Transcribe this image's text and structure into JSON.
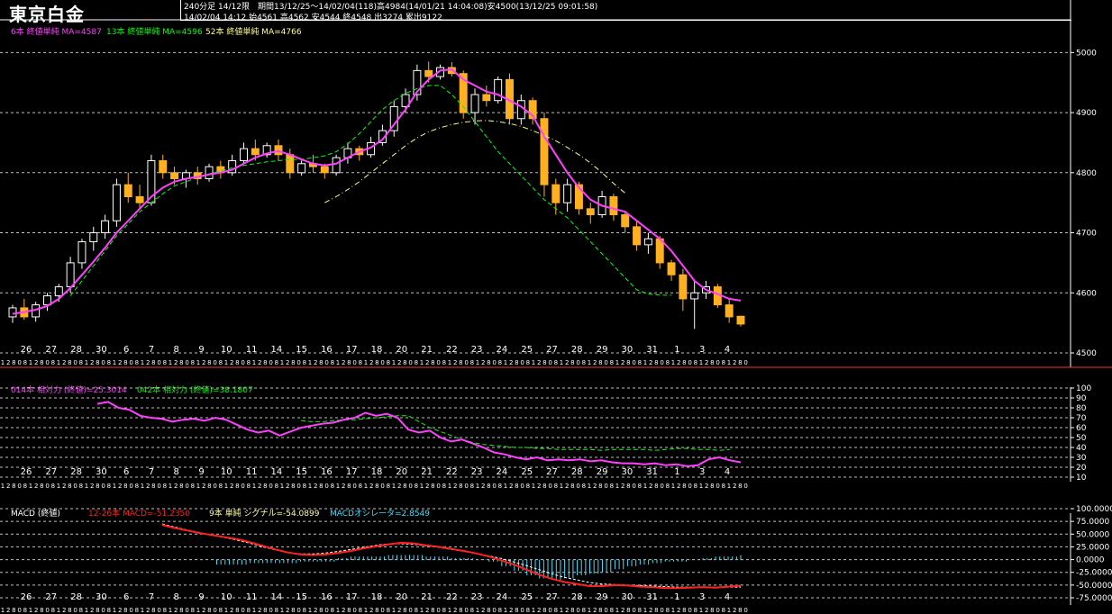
{
  "header": {
    "title": "東京白金",
    "line1": "240分足 14/12限　期間13/12/25〜14/02/04(118)高4984(14/01/21 14:04:08)安4500(13/12/25 09:01:58)",
    "line2": "14/02/04 14:12 始4561 高4562 安4544 終4548 出3274 累出9122"
  },
  "colors": {
    "up": "#ffffff",
    "down": "#ffb020",
    "ma6": "#ff40ff",
    "ma13": "#00ff00",
    "ma52": "#ffff80",
    "rsi14": "#ff40ff",
    "rsi42": "#00ff00",
    "macd": "#ff2020",
    "signal": "#ffffff",
    "osc": "#40e0ff",
    "grid": "#ffffff",
    "separator": "#ff3030"
  },
  "legends": {
    "price": [
      "6本 終値単純 MA=4587",
      "13本 終値単純 MA=4596",
      "52本 終値単純 MA=4766"
    ],
    "rsi": [
      "014本 相対力 (終値)=25.3014",
      "042本 相対力 (終値)=38.1807"
    ],
    "macd": [
      "MACD (終値)",
      "12-26本 MACD=-51.2350",
      "9本 単純 シグナル=-54.0899",
      "MACDオシレータ=2.8549"
    ]
  },
  "chart_data": [
    {
      "type": "candlestick",
      "ylim": [
        4500,
        5020
      ],
      "yticks": [
        "5000",
        "4900",
        "4800",
        "4700",
        "4600",
        "4500"
      ],
      "date_labels": [
        "26",
        "27",
        "28",
        "30",
        "6",
        "7",
        "8",
        "9",
        "10",
        "11",
        "14",
        "15",
        "16",
        "17",
        "18",
        "20",
        "21",
        "22",
        "23",
        "24",
        "25",
        "27",
        "28",
        "29",
        "30",
        "31",
        "1",
        "3",
        "4"
      ],
      "session_labels": [
        "1",
        "2",
        "8",
        "0",
        "8",
        "1",
        "2",
        "8",
        "0",
        "8"
      ],
      "candles": [
        [
          4560,
          4580,
          4550,
          4575
        ],
        [
          4575,
          4590,
          4555,
          4560
        ],
        [
          4560,
          4585,
          4552,
          4580
        ],
        [
          4580,
          4600,
          4570,
          4595
        ],
        [
          4595,
          4615,
          4585,
          4610
        ],
        [
          4610,
          4660,
          4600,
          4650
        ],
        [
          4650,
          4690,
          4640,
          4685
        ],
        [
          4685,
          4710,
          4670,
          4700
        ],
        [
          4700,
          4730,
          4690,
          4720
        ],
        [
          4720,
          4790,
          4710,
          4780
        ],
        [
          4780,
          4800,
          4750,
          4760
        ],
        [
          4760,
          4780,
          4740,
          4750
        ],
        [
          4750,
          4830,
          4745,
          4820
        ],
        [
          4820,
          4830,
          4790,
          4800
        ],
        [
          4800,
          4810,
          4780,
          4790
        ],
        [
          4790,
          4805,
          4775,
          4800
        ],
        [
          4800,
          4810,
          4780,
          4790
        ],
        [
          4790,
          4815,
          4785,
          4810
        ],
        [
          4810,
          4820,
          4790,
          4800
        ],
        [
          4800,
          4830,
          4795,
          4820
        ],
        [
          4820,
          4850,
          4815,
          4840
        ],
        [
          4840,
          4855,
          4820,
          4830
        ],
        [
          4830,
          4850,
          4825,
          4845
        ],
        [
          4845,
          4855,
          4820,
          4830
        ],
        [
          4830,
          4840,
          4790,
          4800
        ],
        [
          4800,
          4820,
          4795,
          4815
        ],
        [
          4815,
          4830,
          4800,
          4810
        ],
        [
          4810,
          4815,
          4790,
          4800
        ],
        [
          4800,
          4830,
          4795,
          4825
        ],
        [
          4825,
          4850,
          4815,
          4840
        ],
        [
          4840,
          4845,
          4820,
          4830
        ],
        [
          4830,
          4860,
          4825,
          4850
        ],
        [
          4850,
          4880,
          4845,
          4870
        ],
        [
          4870,
          4920,
          4860,
          4910
        ],
        [
          4910,
          4940,
          4900,
          4930
        ],
        [
          4930,
          4980,
          4920,
          4970
        ],
        [
          4970,
          4985,
          4950,
          4960
        ],
        [
          4960,
          4980,
          4955,
          4975
        ],
        [
          4975,
          4984,
          4960,
          4965
        ],
        [
          4965,
          4970,
          4890,
          4900
        ],
        [
          4900,
          4940,
          4880,
          4930
        ],
        [
          4930,
          4945,
          4910,
          4920
        ],
        [
          4920,
          4960,
          4915,
          4955
        ],
        [
          4955,
          4965,
          4880,
          4890
        ],
        [
          4890,
          4930,
          4880,
          4920
        ],
        [
          4920,
          4925,
          4880,
          4890
        ],
        [
          4890,
          4900,
          4760,
          4780
        ],
        [
          4780,
          4790,
          4730,
          4750
        ],
        [
          4750,
          4790,
          4735,
          4780
        ],
        [
          4780,
          4785,
          4730,
          4740
        ],
        [
          4740,
          4750,
          4715,
          4730
        ],
        [
          4730,
          4770,
          4725,
          4760
        ],
        [
          4760,
          4765,
          4720,
          4730
        ],
        [
          4730,
          4735,
          4700,
          4710
        ],
        [
          4710,
          4720,
          4670,
          4680
        ],
        [
          4680,
          4700,
          4665,
          4690
        ],
        [
          4690,
          4695,
          4640,
          4650
        ],
        [
          4650,
          4655,
          4620,
          4630
        ],
        [
          4630,
          4640,
          4570,
          4590
        ],
        [
          4590,
          4620,
          4540,
          4600
        ],
        [
          4600,
          4620,
          4590,
          4610
        ],
        [
          4610,
          4615,
          4575,
          4580
        ],
        [
          4580,
          4590,
          4550,
          4560
        ],
        [
          4561,
          4562,
          4544,
          4548
        ]
      ],
      "ma6_values": [
        4565,
        4568,
        4572,
        4578,
        4590,
        4608,
        4630,
        4652,
        4675,
        4700,
        4720,
        4740,
        4760,
        4775,
        4785,
        4790,
        4793,
        4797,
        4800,
        4805,
        4815,
        4825,
        4832,
        4836,
        4830,
        4822,
        4815,
        4812,
        4815,
        4825,
        4835,
        4842,
        4855,
        4880,
        4905,
        4935,
        4955,
        4970,
        4972,
        4955,
        4945,
        4935,
        4930,
        4920,
        4910,
        4895,
        4860,
        4830,
        4800,
        4775,
        4755,
        4745,
        4740,
        4735,
        4720,
        4705,
        4690,
        4670,
        4645,
        4620,
        4605,
        4598,
        4590,
        4587
      ],
      "ma13_start_index": 5,
      "ma13_values": [
        4595,
        4620,
        4645,
        4670,
        4695,
        4715,
        4735,
        4750,
        4765,
        4778,
        4785,
        4792,
        4798,
        4803,
        4808,
        4812,
        4815,
        4818,
        4820,
        4822,
        4822,
        4825,
        4828,
        4835,
        4848,
        4865,
        4885,
        4905,
        4920,
        4932,
        4940,
        4945,
        4945,
        4930,
        4910,
        4885,
        4860,
        4835,
        4815,
        4795,
        4775,
        4755,
        4740,
        4725,
        4705,
        4685,
        4665,
        4645,
        4625,
        4605,
        4598,
        4596,
        4596
      ],
      "ma52_start_index": 27,
      "ma52_values": [
        4750,
        4760,
        4772,
        4785,
        4800,
        4815,
        4830,
        4845,
        4858,
        4868,
        4875,
        4880,
        4884,
        4886,
        4887,
        4885,
        4882,
        4877,
        4870,
        4862,
        4853,
        4842,
        4830,
        4816,
        4800,
        4782,
        4766
      ]
    },
    {
      "type": "line",
      "ylim": [
        10,
        100
      ],
      "yticks": [
        "100",
        "90",
        "80",
        "70",
        "60",
        "50",
        "40",
        "30",
        "20",
        "10"
      ],
      "rsi14_values": [
        84,
        86,
        80,
        78,
        72,
        70,
        69,
        66,
        68,
        69,
        67,
        70,
        68,
        63,
        58,
        55,
        57,
        52,
        56,
        60,
        62,
        64,
        65,
        68,
        70,
        75,
        72,
        74,
        70,
        58,
        55,
        57,
        50,
        46,
        48,
        44,
        40,
        35,
        33,
        30,
        28,
        30,
        27,
        28,
        27,
        28,
        26,
        27,
        25,
        24,
        24,
        23,
        24,
        22,
        23,
        21,
        22,
        28,
        30,
        27,
        25
      ],
      "rsi42_start_index": 19,
      "rsi42_values": [
        67,
        66,
        66,
        67,
        68,
        68,
        69,
        70,
        71,
        72,
        72,
        66,
        60,
        56,
        52,
        48,
        45,
        43,
        42,
        41,
        40,
        40,
        39,
        39,
        38,
        38,
        38,
        38,
        37,
        38,
        38,
        38,
        38,
        37,
        38,
        39,
        39,
        38,
        38,
        37,
        38
      ]
    },
    {
      "type": "line",
      "ylim": [
        -75,
        100
      ],
      "yticks": [
        "100.0000",
        "75.0000",
        "50.0000",
        "25.0000",
        "0.0000",
        "-25.0000",
        "-50.0000",
        "-75.0000"
      ],
      "macd_values": [
        68,
        62,
        57,
        52,
        48,
        44,
        40,
        34,
        27,
        20,
        14,
        10,
        9,
        10,
        13,
        17,
        22,
        26,
        30,
        33,
        32,
        28,
        25,
        21,
        17,
        12,
        6,
        -2,
        -10,
        -20,
        -30,
        -38,
        -44,
        -48,
        -52,
        -52,
        -50,
        -51,
        -53,
        -54,
        -56,
        -56,
        -55,
        -54,
        -55,
        -53,
        -51
      ],
      "signal_values": [
        70,
        64,
        58,
        53,
        48,
        43,
        38,
        32,
        25,
        19,
        14,
        11,
        11,
        13,
        16,
        20,
        24,
        28,
        31,
        31,
        30,
        27,
        24,
        20,
        16,
        12,
        7,
        2,
        -5,
        -12,
        -20,
        -28,
        -35,
        -40,
        -45,
        -48,
        -49,
        -50,
        -51,
        -52,
        -53,
        -54,
        -54,
        -54,
        -54,
        -54,
        -54
      ],
      "osc_values": [
        -3,
        -3,
        -3,
        -3,
        -3,
        -3,
        -3,
        -2,
        -2,
        -2,
        -2,
        -1,
        -1,
        -1,
        1,
        2,
        2,
        2,
        3,
        3,
        3,
        2,
        2,
        1,
        1,
        0,
        -1,
        -4,
        -7,
        -10,
        -12,
        -13,
        -12,
        -10,
        -9,
        -8,
        -6,
        -4,
        -3,
        -2,
        -1,
        -1,
        0,
        1,
        2,
        2,
        3
      ]
    }
  ]
}
